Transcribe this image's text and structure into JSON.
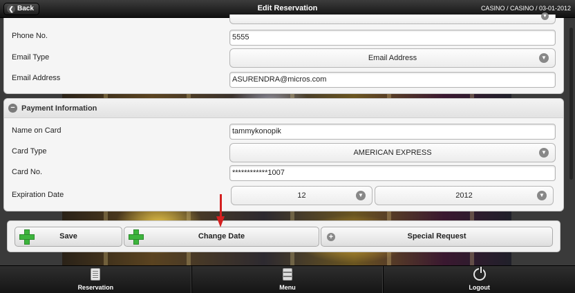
{
  "header": {
    "back_label": "Back",
    "title": "Edit Reservation",
    "context": "CASINO / CASINO / 03-01-2012"
  },
  "contact": {
    "phone_label": "Phone No.",
    "phone_value": "5555",
    "email_type_label": "Email Type",
    "email_type_value": "Email Address",
    "email_address_label": "Email Address",
    "email_address_value": "ASURENDRA@micros.com"
  },
  "payment": {
    "section_title": "Payment Information",
    "name_label": "Name on Card",
    "name_value": "tammykonopik",
    "card_type_label": "Card Type",
    "card_type_value": "AMERICAN EXPRESS",
    "card_no_label": "Card No.",
    "card_no_value": "************1007",
    "expiration_label": "Expiration Date",
    "expiration_month": "12",
    "expiration_year": "2012"
  },
  "actions": {
    "save_label": "Save",
    "change_date_label": "Change Date",
    "special_request_label": "Special Request"
  },
  "footer": {
    "reservation_label": "Reservation",
    "menu_label": "Menu",
    "logout_label": "Logout"
  },
  "icons": {
    "back": "chevron-left-icon",
    "collapse": "minus-circle-icon",
    "dropdown": "chevron-down-icon",
    "add": "plus-icon",
    "reservation": "document-icon",
    "menu": "menu-icon",
    "logout": "power-icon",
    "annotation": "red-arrow"
  },
  "colors": {
    "header_bg": "#1a1a1a",
    "plus_green": "#3db43d",
    "arrow_red": "#d42020"
  }
}
